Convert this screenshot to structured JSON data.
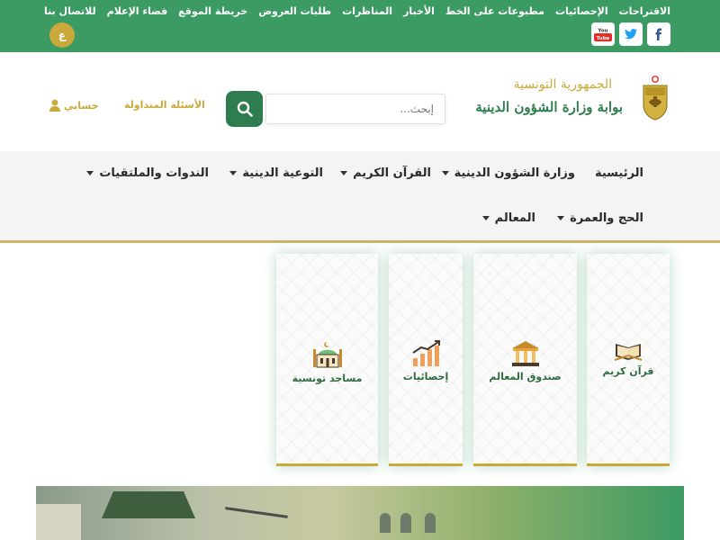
{
  "top_links": [
    "الاقتراحات",
    "الإحصائيات",
    "مطبوعات على الخط",
    "الأخبار",
    "المناظرات",
    "طلبات العروض",
    "خريطة الموقع",
    "فضاء الإعلام",
    "للاتصال بنا"
  ],
  "social": {
    "facebook_icon": "facebook-icon",
    "twitter_icon": "twitter-icon",
    "youtube_icon": "youtube-icon",
    "youtube_text": "You Tube"
  },
  "lang_button": "ع",
  "brand": {
    "subtitle": "الجمهورية التونسية",
    "title": "بوابة وزارة الشؤون الدينية"
  },
  "search": {
    "placeholder": "إبحث..."
  },
  "faq": "الأسئلة المتداولة",
  "account": "حسابي",
  "nav": {
    "row1": [
      "الرئيسية",
      "وزارة الشؤون الدينية",
      "القرآن الكريم",
      "التوعية الدينية",
      "الندوات والملتقيات"
    ],
    "row2": [
      "الحج والعمرة",
      "المعالم"
    ]
  },
  "cards": [
    "قرآن كريم",
    "صندوق المعالم",
    "إحصائيات",
    "مساجد تونسية"
  ],
  "colors": {
    "primary_green": "#3c9a63",
    "dark_green": "#2f7d4f",
    "gold": "#c9a93b"
  }
}
